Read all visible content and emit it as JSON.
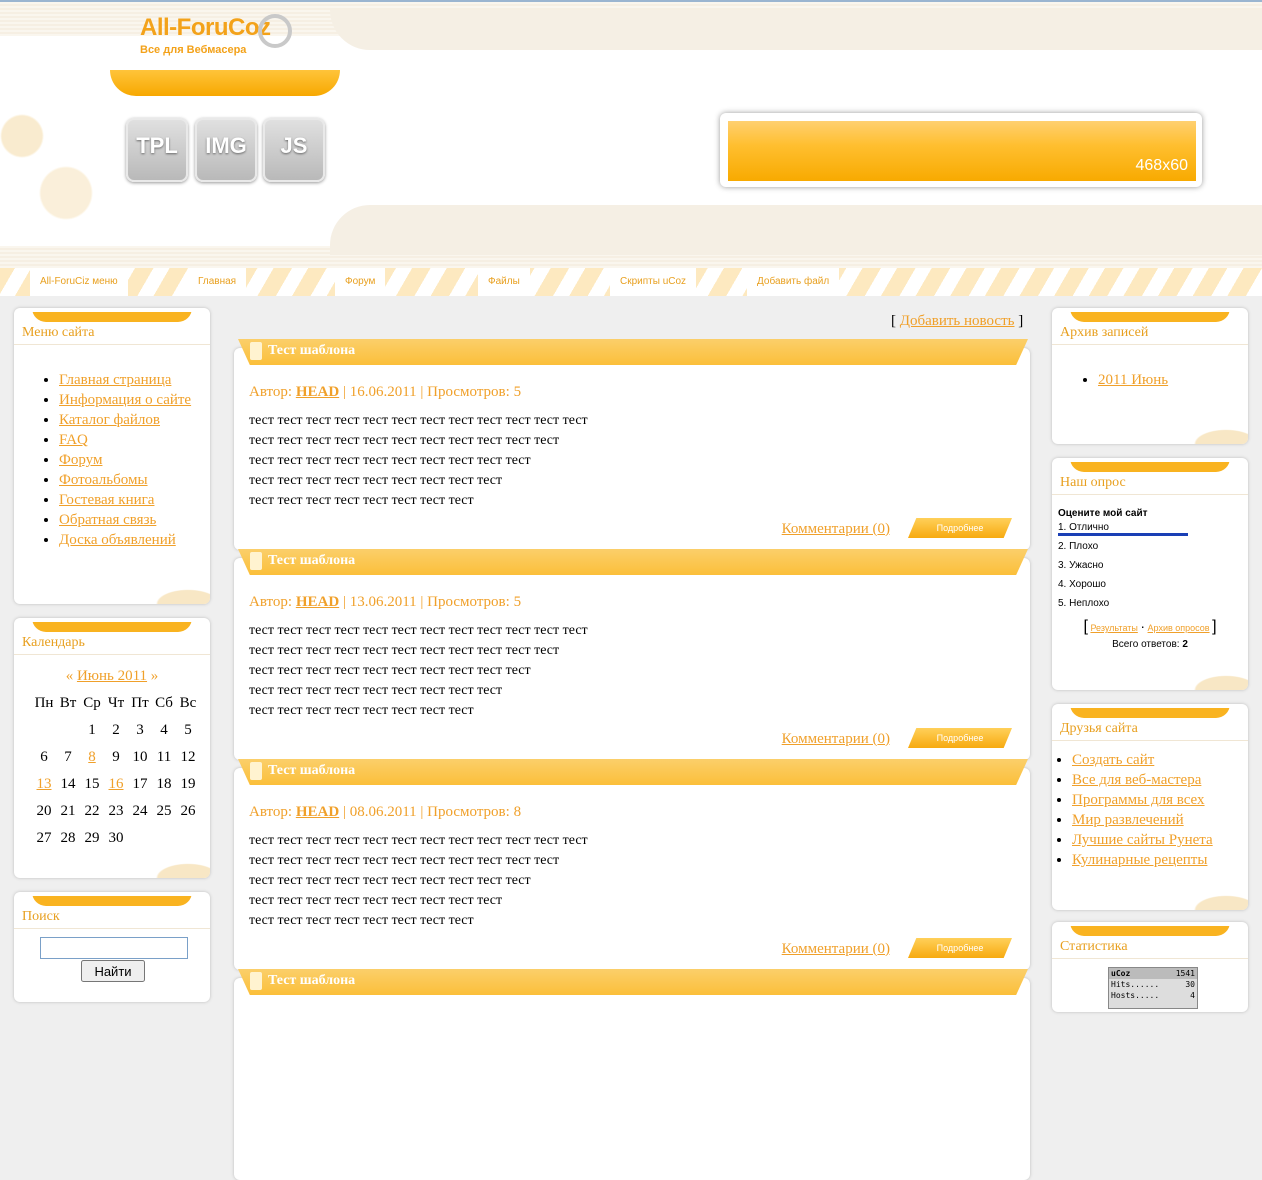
{
  "header": {
    "logo_title": "All-ForuCoz",
    "logo_subtitle": "Все для Вебмасера",
    "buttons": [
      "TPL",
      "IMG",
      "JS"
    ],
    "banner_label": "468x60"
  },
  "nav": {
    "items": [
      "All-ForuCiz меню",
      "Главная",
      "Форум",
      "Файлы",
      "Скрипты uCoz",
      "Добавить файл"
    ]
  },
  "left": {
    "menu_title": "Меню сайта",
    "menu_items": [
      "Главная страница",
      "Информация о сайте",
      "Каталог файлов",
      "FAQ",
      "Форум",
      "Фотоальбомы",
      "Гостевая книга",
      "Обратная связь",
      "Доска объявлений"
    ],
    "calendar_title": "Календарь",
    "calendar_prev": "«",
    "calendar_month": "Июнь 2011",
    "calendar_next": "»",
    "calendar_days": [
      "Пн",
      "Вт",
      "Ср",
      "Чт",
      "Пт",
      "Сб",
      "Вс"
    ],
    "calendar_rows": [
      [
        "",
        "",
        "1",
        "2",
        "3",
        "4",
        "5"
      ],
      [
        "6",
        "7",
        "8",
        "9",
        "10",
        "11",
        "12"
      ],
      [
        "13",
        "14",
        "15",
        "16",
        "17",
        "18",
        "19"
      ],
      [
        "20",
        "21",
        "22",
        "23",
        "24",
        "25",
        "26"
      ],
      [
        "27",
        "28",
        "29",
        "30",
        "",
        "",
        ""
      ]
    ],
    "calendar_links": [
      "8",
      "13",
      "16"
    ],
    "search_title": "Поиск",
    "search_value": "",
    "search_button": "Найти"
  },
  "main": {
    "add_news_open": "[",
    "add_news": "Добавить новость",
    "add_news_close": "]",
    "posts": [
      {
        "title": "Тест шаблона",
        "author_label": "Автор:",
        "author": "HEAD",
        "date": "16.06.2011",
        "views_label": "Просмотров:",
        "views": "5",
        "comments": "Комментарии (0)",
        "more": "Подробнее"
      },
      {
        "title": "Тест шаблона",
        "author_label": "Автор:",
        "author": "HEAD",
        "date": "13.06.2011",
        "views_label": "Просмотров:",
        "views": "5",
        "comments": "Комментарии (0)",
        "more": "Подробнее"
      },
      {
        "title": "Тест шаблона",
        "author_label": "Автор:",
        "author": "HEAD",
        "date": "08.06.2011",
        "views_label": "Просмотров:",
        "views": "8",
        "comments": "Комментарии (0)",
        "more": "Подробнее"
      },
      {
        "title": "Тест шаблона"
      }
    ],
    "post_lines": [
      "тест тест тест тест тест тест тест тест тест тест тест тест",
      "тест тест тест тест тест тест тест тест тест тест тест",
      "тест тест тест тест тест тест тест тест тест тест",
      "тест тест тест тест тест тест тест тест тест",
      "тест тест тест тест тест тест тест тест"
    ]
  },
  "right": {
    "archive_title": "Архив записей",
    "archive_items": [
      "2011 Июнь"
    ],
    "poll_title": "Наш опрос",
    "poll_question": "Оцените мой сайт",
    "poll_options": [
      "1. Отлично",
      "2. Плохо",
      "3. Ужасно",
      "4. Хорошо",
      "5. Неплохо"
    ],
    "poll_results": "Результаты",
    "poll_archive": "Архив опросов",
    "poll_total_label": "Всего ответов:",
    "poll_total": "2",
    "friends_title": "Друзья сайта",
    "friends_items": [
      "Создать сайт",
      "Все для веб-мастера",
      "Программы для всех",
      "Мир развлечений",
      "Лучшие сайты Рунета",
      "Кулинарные рецепты"
    ],
    "stats_title": "Статистика",
    "counter": {
      "logo": "uCoz",
      "count": "1541",
      "hits_label": "Hits......",
      "hits": "30",
      "hosts_label": "Hosts.....",
      "hosts": "4"
    }
  },
  "colors": {
    "accent": "#f0a02a",
    "tab": "#f9b320"
  }
}
